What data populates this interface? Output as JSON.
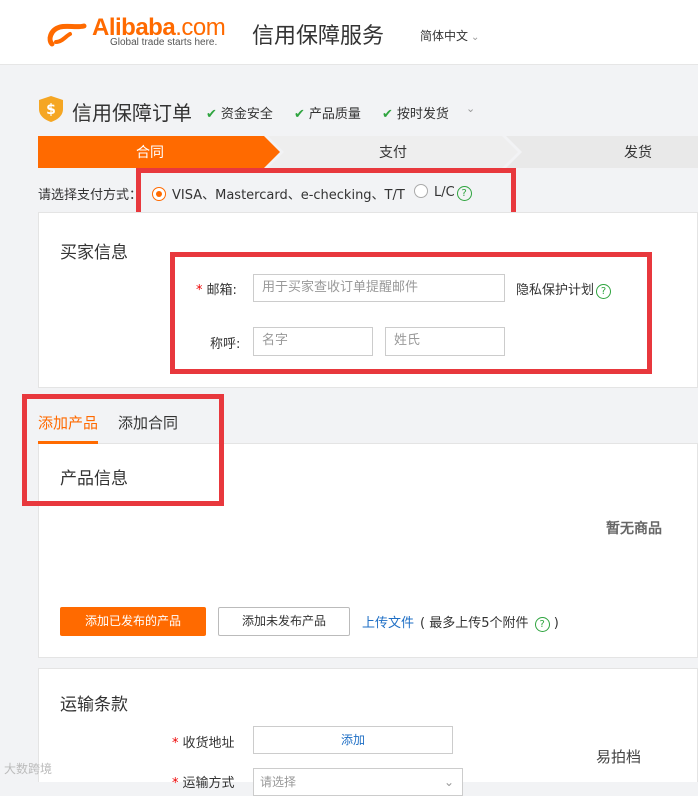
{
  "header": {
    "logo_brand": "Alibaba",
    "logo_com": ".com",
    "logo_slogan": "Global trade starts here.",
    "service_title": "信用保障服务",
    "language": "简体中文",
    "brand_color": "#ff6a00"
  },
  "title_row": {
    "page_title": "信用保障订单",
    "features": [
      "资金安全",
      "产品质量",
      "按时发货"
    ],
    "dropdown_icon": "chevron-down-icon"
  },
  "steps": {
    "items": [
      "合同",
      "支付",
      "发货"
    ],
    "active_index": 0,
    "active_color": "#ff6a00"
  },
  "payment": {
    "label": "请选择支付方式：",
    "options": [
      {
        "label": "VISA、Mastercard、e-checking、T/T",
        "selected": true
      },
      {
        "label": "L/C",
        "selected": false
      }
    ],
    "help_icon": "?"
  },
  "buyer": {
    "title": "买家信息",
    "email_required_mark": "*",
    "email_label": "邮箱:",
    "email_placeholder": "用于买家查收订单提醒邮件",
    "privacy_link": "隐私保护计划",
    "help_icon": "?",
    "name_label": "称呼:",
    "first_name_placeholder": "名字",
    "last_name_placeholder": "姓氏"
  },
  "tabs": {
    "items": [
      "添加产品",
      "添加合同"
    ],
    "active_index": 0
  },
  "product": {
    "title": "产品信息",
    "empty_text": "暂无商品",
    "btn_published": "添加已发布的产品",
    "btn_unpublished": "添加未发布产品",
    "upload_link": "上传文件",
    "upload_note_prefix": "( 最多上传5个附件",
    "upload_note_suffix": ")",
    "help_icon": "?"
  },
  "shipping": {
    "title": "运输条款",
    "required_mark": "*",
    "address_label": "收货地址",
    "address_button": "添加",
    "method_label": "运输方式",
    "method_placeholder": "请选择"
  },
  "watermarks": {
    "left": "大数跨境",
    "right": "易拍档"
  },
  "annotation_color": "#e8383d"
}
